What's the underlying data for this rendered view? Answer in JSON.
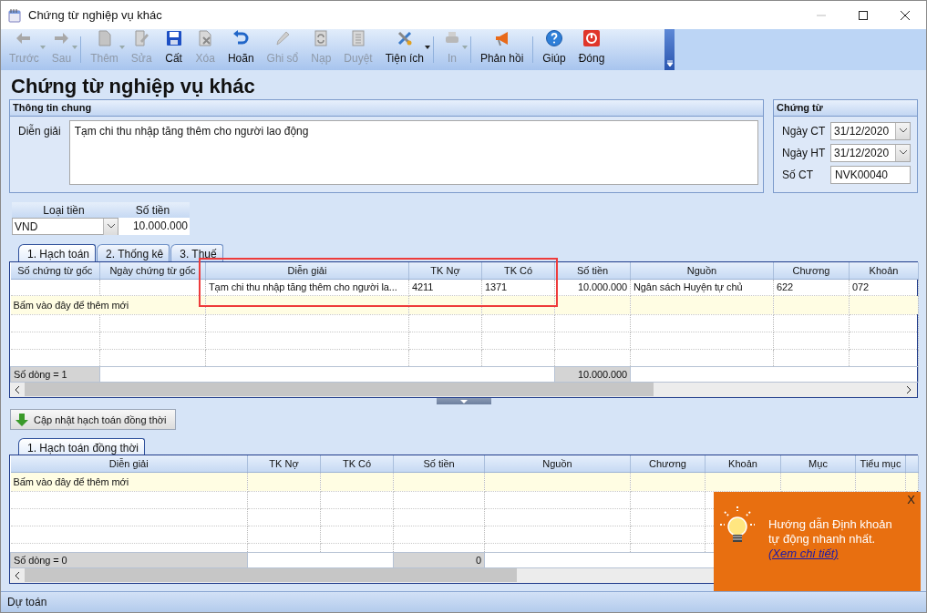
{
  "window": {
    "title": "Chứng từ nghiệp vụ khác"
  },
  "toolbar": {
    "groups": [
      [
        {
          "label": "Trước",
          "disabled": true,
          "dropdown": true
        },
        {
          "label": "Sau",
          "disabled": true,
          "dropdown": true
        }
      ],
      [
        {
          "label": "Thêm",
          "disabled": true,
          "dropdown": true
        },
        {
          "label": "Sửa",
          "disabled": true,
          "dropdown": false
        },
        {
          "label": "Cất",
          "disabled": false,
          "dropdown": false
        },
        {
          "label": "Xóa",
          "disabled": true,
          "dropdown": false
        },
        {
          "label": "Hoãn",
          "disabled": false,
          "dropdown": false
        },
        {
          "label": "Ghi sổ",
          "disabled": true,
          "dropdown": false
        },
        {
          "label": "Nạp",
          "disabled": true,
          "dropdown": false
        },
        {
          "label": "Duyệt",
          "disabled": true,
          "dropdown": false
        },
        {
          "label": "Tiện ích",
          "disabled": false,
          "dropdown": true
        }
      ],
      [
        {
          "label": "In",
          "disabled": true,
          "dropdown": true
        }
      ],
      [
        {
          "label": "Phản hồi",
          "disabled": false,
          "dropdown": false
        }
      ],
      [
        {
          "label": "Giúp",
          "disabled": false,
          "dropdown": false
        },
        {
          "label": "Đóng",
          "disabled": false,
          "dropdown": false
        }
      ]
    ]
  },
  "heading": "Chứng từ nghiệp vụ khác",
  "general_info": {
    "title": "Thông tin chung",
    "description_label": "Diễn giải",
    "description": "Tạm chi thu nhập tăng thêm cho người lao động"
  },
  "voucher": {
    "title": "Chứng từ",
    "fields": [
      {
        "label": "Ngày CT",
        "value": "31/12/2020",
        "kind": "date"
      },
      {
        "label": "Ngày HT",
        "value": "31/12/2020",
        "kind": "date"
      },
      {
        "label": "Số CT",
        "value": "NVK00040",
        "kind": "text"
      }
    ]
  },
  "currency": {
    "columns": [
      "Loại tiền",
      "Số tiền"
    ],
    "currency": "VND",
    "amount": "10.000.000"
  },
  "tabs": [
    {
      "label": "1. Hạch toán",
      "selected": true
    },
    {
      "label": "2. Thống kê",
      "selected": false
    },
    {
      "label": "3. Thuế",
      "selected": false
    }
  ],
  "entries_table": {
    "columns": [
      "Số chứng từ gốc",
      "Ngày chứng từ gốc",
      "Diễn giải",
      "TK Nợ",
      "TK Có",
      "Số tiền",
      "Nguồn",
      "Chương",
      "Khoản"
    ],
    "rows": [
      [
        "",
        "",
        "Tạm chi thu nhập tăng thêm cho người la...",
        "4211",
        "1371",
        "10.000.000",
        "Ngân sách Huyện tự chủ",
        "622",
        "072"
      ]
    ],
    "add_row": "Bấm vào đây để thêm mới",
    "row_count": "Số dòng = 1",
    "total": "10.000.000"
  },
  "sync_button": "Cập nhật hạch toán đồng thời",
  "sync_tabs": [
    {
      "label": "1. Hạch toán đồng thời",
      "selected": true
    }
  ],
  "sync_table": {
    "columns": [
      "Diễn giải",
      "TK Nợ",
      "TK Có",
      "Số tiền",
      "Nguồn",
      "Chương",
      "Khoản",
      "Mục",
      "Tiểu mục"
    ],
    "add_row": "Bấm vào đây để thêm mới",
    "row_count": "Số dòng = 0",
    "total": "0"
  },
  "tip": {
    "close": "X",
    "text": "Hướng dẫn Định khoản tự động nhanh nhất.",
    "link": "(Xem chi tiết)"
  },
  "status_bar": "Dự toán"
}
